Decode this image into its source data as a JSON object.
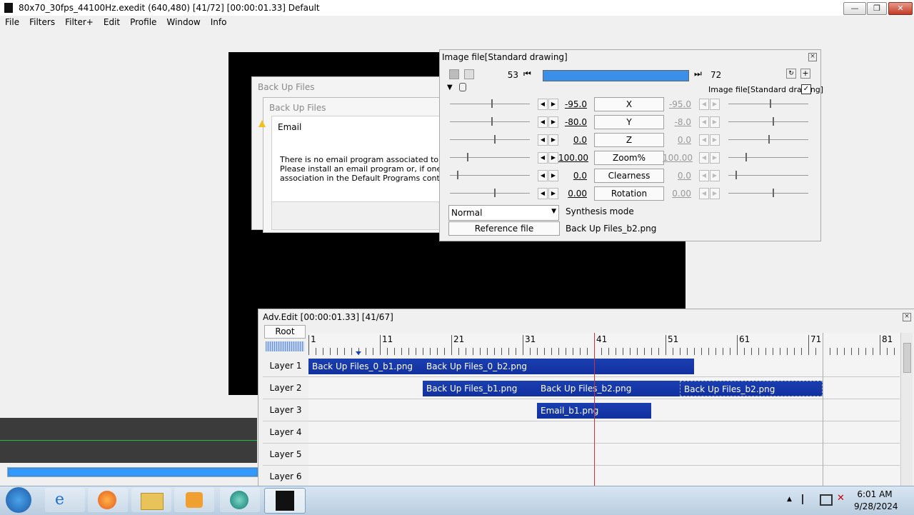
{
  "window": {
    "title": "80x70_30fps_44100Hz.exedit (640,480)  [41/72] [00:00:01.33]  Default",
    "btn_min": "—",
    "btn_max": "❐",
    "btn_close": "✕"
  },
  "menu": [
    "File",
    "Filters",
    "Filter+",
    "Edit",
    "Profile",
    "Window",
    "Info"
  ],
  "preview": {
    "dialog_back_title": "Back Up Files",
    "dialog_front_title": "Back Up Files",
    "email_title": "Email",
    "email_line1": "There is no email program associated to pe",
    "email_line2": "Please install an email program or, if one is",
    "email_line3": "association in the Default Programs contro"
  },
  "image_panel": {
    "title": "Image file[Standard drawing]",
    "frame_start": "53",
    "frame_end": "72",
    "frame_progress": 1.0,
    "checkbox_label": "Image file[Standard drawing]",
    "checkbox_checked": true,
    "params": [
      {
        "left": "-95.0",
        "name": "X",
        "right": "-95.0"
      },
      {
        "left": "-80.0",
        "name": "Y",
        "right": "-8.0"
      },
      {
        "left": "0.0",
        "name": "Z",
        "right": "0.0"
      },
      {
        "left": "100.00",
        "name": "Zoom%",
        "right": "100.00"
      },
      {
        "left": "0.0",
        "name": "Clearness",
        "right": "0.0"
      },
      {
        "left": "0.00",
        "name": "Rotation",
        "right": "0.00"
      }
    ],
    "synthesis_value": "Normal",
    "synthesis_label": "Synthesis mode",
    "reference_button": "Reference file",
    "reference_file": "Back Up Files_b2.png"
  },
  "adv_edit": {
    "title": "Adv.Edit [00:00:01.33] [41/67]",
    "root_button": "Root",
    "ruler_labels": [
      "1",
      "11",
      "21",
      "31",
      "41",
      "51",
      "61",
      "71",
      "81"
    ],
    "layers": [
      "Layer 1",
      "Layer 2",
      "Layer 3",
      "Layer 4",
      "Layer 5",
      "Layer 6"
    ],
    "clips": [
      {
        "layer": 0,
        "label": "Back Up Files_0_b1.png"
      },
      {
        "layer": 0,
        "label": "Back Up Files_0_b2.png"
      },
      {
        "layer": 1,
        "label": "Back Up Files_b1.png"
      },
      {
        "layer": 1,
        "label": "Back Up Files_b2.png"
      },
      {
        "layer": 1,
        "label": "Back Up Files_b2.png"
      },
      {
        "layer": 2,
        "label": "Email_b1.png"
      }
    ]
  },
  "taskbar": {
    "time": "6:01 AM",
    "date": "9/28/2024"
  },
  "colors": {
    "clip": "#1a3fb0",
    "frame_bar": "#3a8fe8",
    "cursor": "#d03030"
  }
}
